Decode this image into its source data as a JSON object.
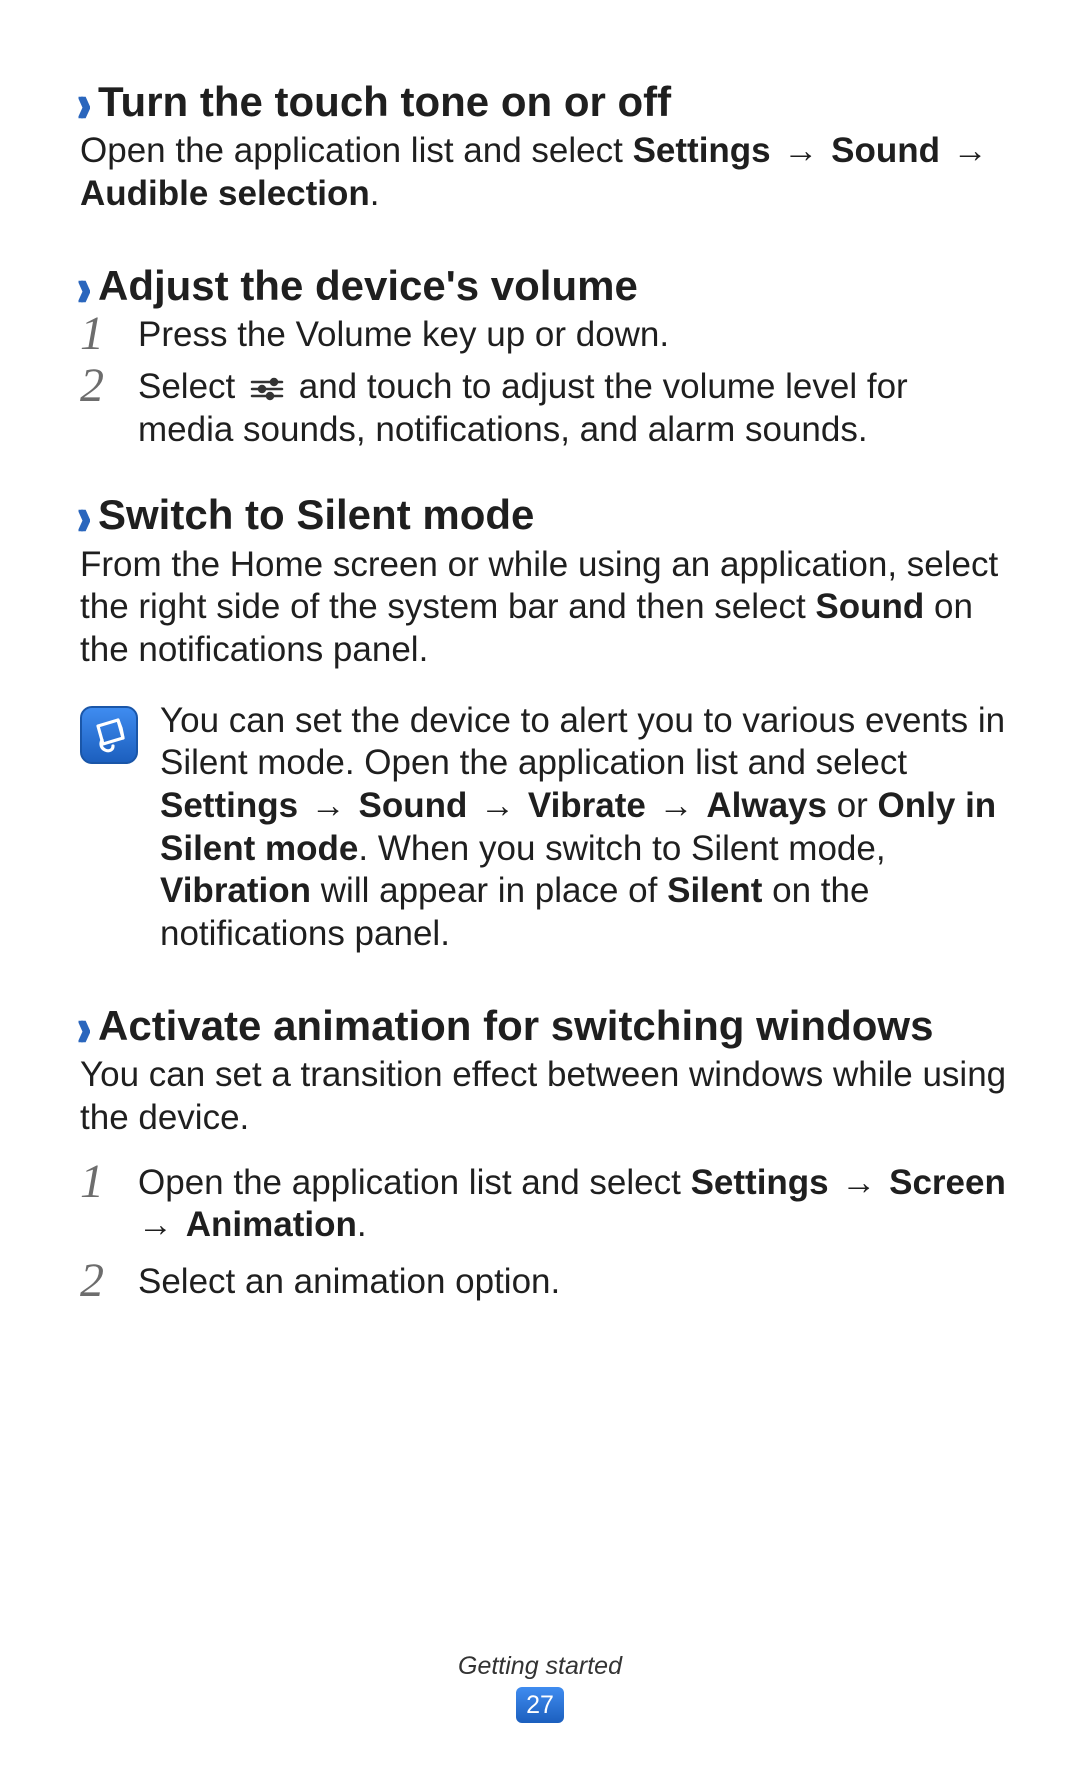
{
  "footer": {
    "section": "Getting started",
    "page": "27"
  },
  "sections": {
    "touchTone": {
      "heading": "Turn the touch tone on or off",
      "p1a": "Open the application list and select ",
      "p1b": "Settings",
      "p1c": " → ",
      "p1d": "Sound",
      "p1e": " → ",
      "p1f": "Audible selection",
      "p1g": "."
    },
    "volume": {
      "heading": "Adjust the device's volume",
      "step1": "Press the Volume key up or down.",
      "step2a": "Select ",
      "step2b": " and touch to adjust the volume level for media sounds, notifications, and alarm sounds."
    },
    "silent": {
      "heading": "Switch to Silent mode",
      "p1a": "From the Home screen or while using an application, select the right side of the system bar and then select ",
      "p1b": "Sound",
      "p1c": " on the notifications panel.",
      "note_a": "You can set the device to alert you to various events in Silent mode. Open the application list and select ",
      "note_b": "Settings",
      "note_c": " → ",
      "note_d": "Sound",
      "note_e": " → ",
      "note_f": "Vibrate",
      "note_g": " → ",
      "note_h": "Always",
      "note_i": " or ",
      "note_j": "Only in Silent mode",
      "note_k": ". When you switch to Silent mode, ",
      "note_l": "Vibration",
      "note_m": " will appear in place of ",
      "note_n": "Silent",
      "note_o": " on the notifications panel."
    },
    "animation": {
      "heading": "Activate animation for switching windows",
      "p1": "You can set a transition effect between windows while using the device.",
      "step1a": "Open the application list and select ",
      "step1b": "Settings",
      "step1c": " → ",
      "step1d": "Screen",
      "step1e": " → ",
      "step1f": "Animation",
      "step1g": ".",
      "step2": "Select an animation option."
    }
  },
  "nums": {
    "n1": "1",
    "n2": "2"
  }
}
